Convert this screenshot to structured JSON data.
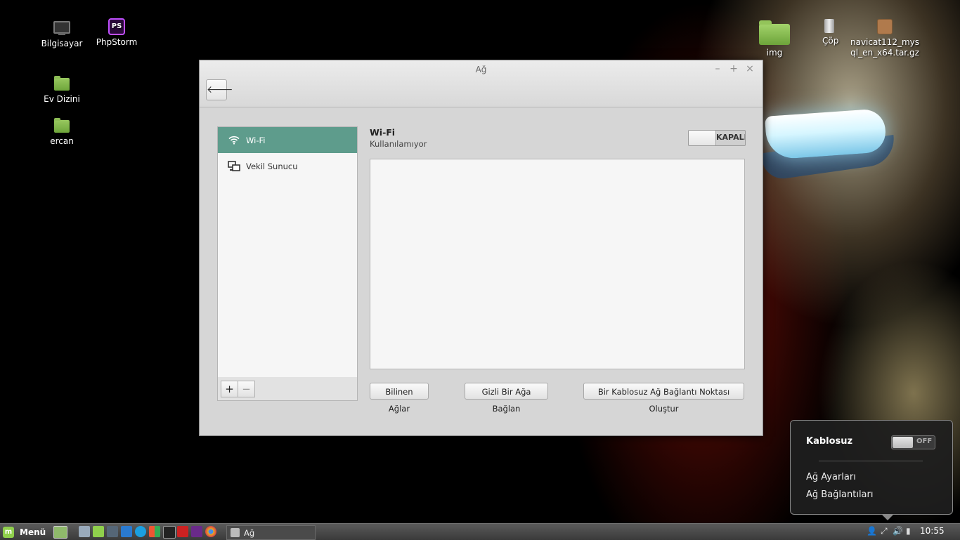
{
  "desktop": {
    "icons_left": [
      {
        "label": "Bilgisayar"
      },
      {
        "label": "PhpStorm"
      },
      {
        "label": "Ev Dizini"
      },
      {
        "label": "ercan"
      }
    ],
    "icons_right": [
      {
        "label": "img"
      },
      {
        "label": "Çöp"
      },
      {
        "label": "navicat112_mysql_en_x64.tar.gz"
      }
    ]
  },
  "window": {
    "title": "Ağ",
    "controls": {
      "minimize": "–",
      "maximize": "+",
      "close": "×"
    },
    "back_glyph": "🡐",
    "sidebar": {
      "items": [
        {
          "label": "Wi-Fi",
          "icon": "wifi-icon",
          "active": true
        },
        {
          "label": "Vekil Sunucu",
          "icon": "proxy-icon",
          "active": false
        }
      ],
      "add_label": "+",
      "remove_label": "−"
    },
    "panel": {
      "title": "Wi-Fi",
      "subtitle": "Kullanılamıyor",
      "switch_label": "KAPALI",
      "buttons": {
        "known_networks": "Bilinen Ağlar",
        "hidden_network": "Gizli Bir Ağa Bağlan",
        "hotspot": "Bir Kablosuz Ağ Bağlantı Noktası Oluştur"
      }
    }
  },
  "taskbar": {
    "menu_label": "Menü",
    "task_label": "Ağ",
    "clock": "10:55"
  },
  "network_popup": {
    "title": "Kablosuz",
    "toggle_label": "OFF",
    "items": [
      "Ağ Ayarları",
      "Ağ Bağlantıları"
    ]
  },
  "colors": {
    "accent": "#5e9c8c",
    "window_bg": "#d6d6d6",
    "taskbar": "#4a4a4a"
  }
}
